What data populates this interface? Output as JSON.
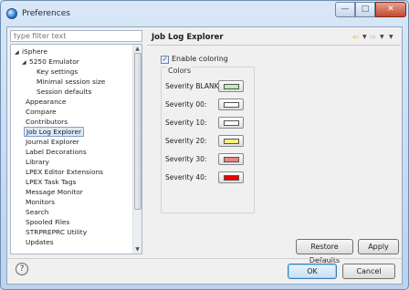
{
  "window": {
    "title": "Preferences",
    "controls": {
      "minimize": "—",
      "maximize": "□",
      "close": "✕"
    }
  },
  "sidebar": {
    "filter_placeholder": "type filter text",
    "items": [
      {
        "label": "iSphere",
        "expander": "◢"
      },
      {
        "label": "5250 Emulator",
        "expander": "◢"
      },
      {
        "label": "Key settings"
      },
      {
        "label": "Minimal session size"
      },
      {
        "label": "Session defaults"
      },
      {
        "label": "Appearance"
      },
      {
        "label": "Compare"
      },
      {
        "label": "Contributors"
      },
      {
        "label": "Job Log Explorer",
        "selected": true
      },
      {
        "label": "Journal Explorer"
      },
      {
        "label": "Label Decorations"
      },
      {
        "label": "Library"
      },
      {
        "label": "LPEX Editor Extensions"
      },
      {
        "label": "LPEX Task Tags"
      },
      {
        "label": "Message Monitor"
      },
      {
        "label": "Monitors"
      },
      {
        "label": "Search"
      },
      {
        "label": "Spooled Files"
      },
      {
        "label": "STRPREPRC Utility"
      },
      {
        "label": "Updates"
      }
    ]
  },
  "page": {
    "title": "Job Log Explorer",
    "nav": {
      "back_icon": "⇦",
      "forward_icon": "⇨",
      "dropdown_icon": "▼"
    },
    "enable_coloring": {
      "label": "Enable coloring",
      "checked": true,
      "mark": "✓"
    },
    "colors_group": {
      "label": "Colors",
      "rows": [
        {
          "label": "Severity BLANK:",
          "color": "#b6f3b0"
        },
        {
          "label": "Severity 00:",
          "color": "#ffffff"
        },
        {
          "label": "Severity 10:",
          "color": "#ffffff"
        },
        {
          "label": "Severity 20:",
          "color": "#f7f17a"
        },
        {
          "label": "Severity 30:",
          "color": "#f08282"
        },
        {
          "label": "Severity 40:",
          "color": "#ee0000"
        }
      ]
    },
    "restore_defaults_label": "Restore Defaults",
    "apply_label": "Apply"
  },
  "footer": {
    "help_icon": "?",
    "ok_label": "OK",
    "cancel_label": "Cancel"
  },
  "colors": {
    "selection_bg": "#dce9f7",
    "window_frame": "#bcd3ec"
  }
}
